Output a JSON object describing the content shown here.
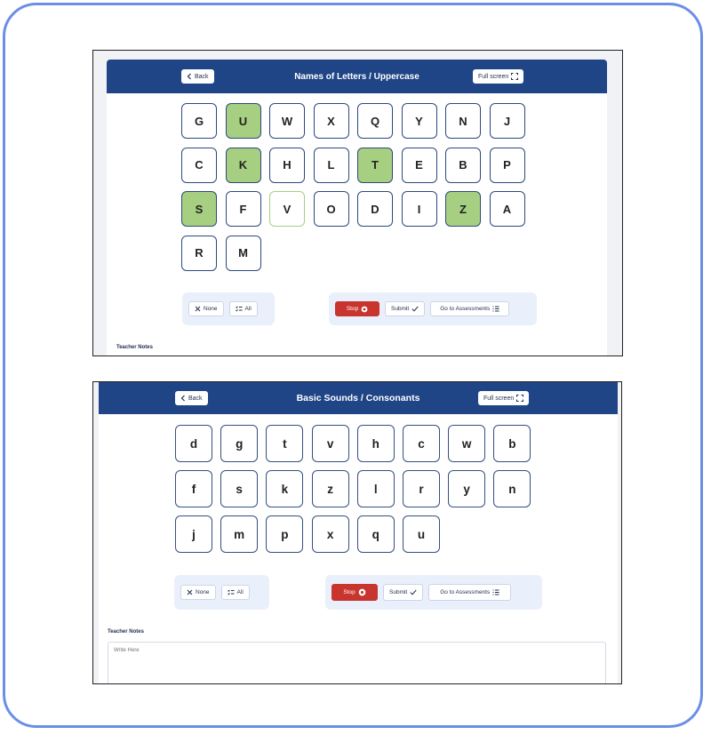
{
  "screen1": {
    "title": "Names of Letters / Uppercase",
    "back_label": "Back",
    "fullscreen_label": "Full screen",
    "letters": [
      "G",
      "U",
      "W",
      "X",
      "Q",
      "Y",
      "N",
      "J",
      "C",
      "K",
      "H",
      "L",
      "T",
      "E",
      "B",
      "P",
      "S",
      "F",
      "V",
      "O",
      "D",
      "I",
      "Z",
      "A",
      "R",
      "M"
    ],
    "selected_letters": [
      "U",
      "K",
      "T",
      "S",
      "Z"
    ],
    "pending_letters": [
      "V"
    ],
    "none_label": "None",
    "all_label": "All",
    "stop_label": "Stop",
    "submit_label": "Submit",
    "assess_label": "Go to Assessments",
    "notes_label": "Teacher Notes"
  },
  "screen2": {
    "title": "Basic Sounds / Consonants",
    "back_label": "Back",
    "fullscreen_label": "Full screen",
    "letters": [
      "d",
      "g",
      "t",
      "v",
      "h",
      "c",
      "w",
      "b",
      "f",
      "s",
      "k",
      "z",
      "l",
      "r",
      "y",
      "n",
      "j",
      "m",
      "p",
      "x",
      "q",
      "u"
    ],
    "none_label": "None",
    "all_label": "All",
    "stop_label": "Stop",
    "submit_label": "Submit",
    "assess_label": "Go to Assessments",
    "notes_label": "Teacher Notes",
    "notes_placeholder": "Write Here"
  },
  "colors": {
    "header": "#1f4586",
    "selected_tile": "#a7cf82",
    "stop_button": "#c8342e",
    "frame_border": "#6b8fe6"
  },
  "icons": [
    "chevron-left-icon",
    "fullscreen-icon",
    "close-icon",
    "checklist-icon",
    "stop-circle-icon",
    "check-icon",
    "list-icon"
  ]
}
